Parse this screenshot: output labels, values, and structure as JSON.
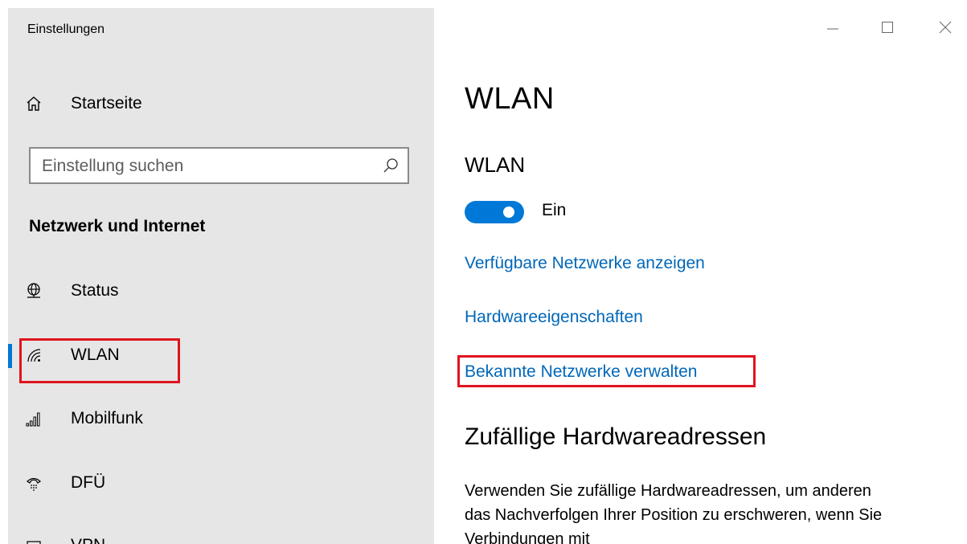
{
  "window": {
    "title": "Einstellungen",
    "controls": {
      "minimize_icon": "minimize-icon",
      "maximize_icon": "maximize-icon",
      "close_icon": "close-icon"
    }
  },
  "sidebar": {
    "home": {
      "label": "Startseite",
      "icon": "home-icon"
    },
    "search": {
      "placeholder": "Einstellung suchen",
      "value": "",
      "icon": "search-icon"
    },
    "section_heading": "Netzwerk und Internet",
    "items": [
      {
        "label": "Status",
        "icon": "globe-icon",
        "selected": false
      },
      {
        "label": "WLAN",
        "icon": "wifi-icon",
        "selected": true
      },
      {
        "label": "Mobilfunk",
        "icon": "cellular-signal-icon",
        "selected": false
      },
      {
        "label": "DFÜ",
        "icon": "dialup-icon",
        "selected": false
      },
      {
        "label": "VPN",
        "icon": "vpn-icon",
        "selected": false
      }
    ]
  },
  "main": {
    "page_title": "WLAN",
    "wifi_section": {
      "title": "WLAN",
      "toggle_state": "Ein",
      "toggle_on": true
    },
    "links": [
      "Verfügbare Netzwerke anzeigen",
      "Hardwareeigenschaften",
      "Bekannte Netzwerke verwalten"
    ],
    "random_hw": {
      "title": "Zufällige Hardwareadressen",
      "description": "Verwenden Sie zufällige Hardwareadressen, um anderen das Nachverfolgen Ihrer Position zu erschweren, wenn Sie Verbindungen mit"
    }
  },
  "colors": {
    "accent": "#0078d7",
    "link": "#0067b8",
    "highlight": "#e0141e",
    "sidebar_bg": "#e6e6e6"
  }
}
